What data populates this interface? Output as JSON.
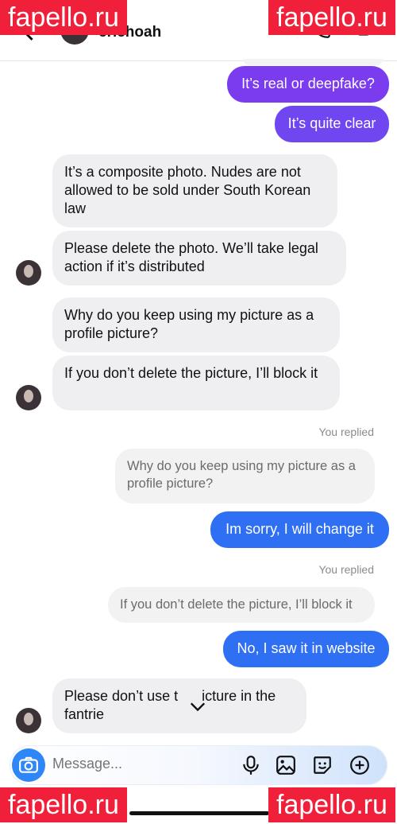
{
  "watermark": {
    "text": "fapello.ru"
  },
  "header": {
    "username": "eriehoah"
  },
  "messages": {
    "out1": "It’s real or deepfake?",
    "out2": "It’s quite clear",
    "in1": "It’s a composite photo. Nudes are not allowed to be sold under South Korean law",
    "in2": "Please delete the photo. We’ll take legal action if it’s distributed",
    "in3": "Why do you keep using my picture as a profile picture?",
    "in4": "If you don’t delete the picture, I’ll block it",
    "replied1": "You replied",
    "reply1": "Why do you keep using my picture as a profile picture?",
    "out3": "Im sorry, I will change it",
    "replied2": "You replied",
    "reply2": "If you don’t delete the picture, I’ll block it",
    "out4": "No, I saw it in website",
    "in5": "Please don’t use t      icture in the fantrie"
  },
  "composer": {
    "placeholder": "Message..."
  },
  "icons": [
    "back-icon",
    "phone-icon",
    "video-icon",
    "camera-icon",
    "microphone-icon",
    "gallery-icon",
    "sticker-icon",
    "add-icon",
    "chevron-down-icon"
  ],
  "colors": {
    "purple": "#7b3cf0",
    "violet": "#6f46ef",
    "blue": "#2f6ff3",
    "incoming": "#efeff1",
    "watermark": "#f0203a"
  }
}
